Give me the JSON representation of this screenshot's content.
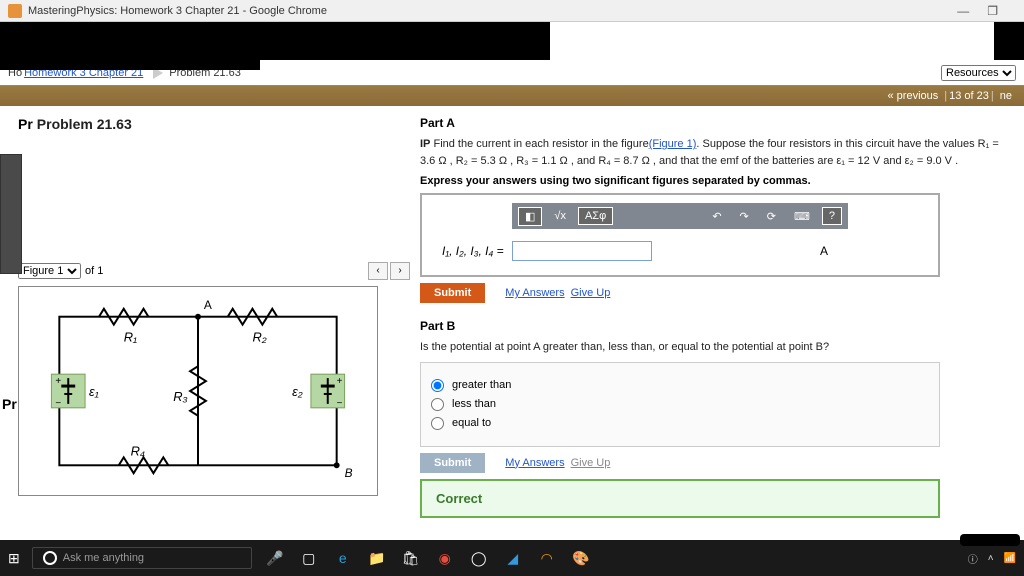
{
  "window": {
    "title": "MasteringPhysics: Homework 3 Chapter 21 - Google Chrome"
  },
  "breadcrumb": {
    "home_prefix": "Ho",
    "link": "Homework 3 Chapter 21",
    "current": "Problem 21.63"
  },
  "resources_label": "Resources",
  "navbar": {
    "prev": "« previous",
    "pos": "13 of 23",
    "next": "ne"
  },
  "problem_title": "Problem 21.63",
  "pr_prefix": "Pr",
  "figure": {
    "select": "Figure 1",
    "of": "of 1"
  },
  "circuit": {
    "R1": "R₁",
    "R2": "R₂",
    "R3": "R₃",
    "R4": "R₄",
    "E1": "ε₁",
    "E2": "ε₂",
    "A": "A",
    "B": "B"
  },
  "partA": {
    "label": "Part A",
    "ip": "IP",
    "prompt1": "Find the current in each resistor in the figure",
    "fig_link": "(Figure 1)",
    "prompt2": ". Suppose the four resistors in this circuit have the values R₁ = 3.6 Ω , R₂ = 5.3 Ω , R₃ = 1.1 Ω , and R₄ = 8.7 Ω , and that the emf of the batteries are ε₁ = 12 V and ε₂ = 9.0 V .",
    "instruct": "Express your answers using two significant figures separated by commas.",
    "toolbar": {
      "t1": "◧",
      "t2": "√x",
      "t3": "ΑΣφ",
      "undo": "↶",
      "redo": "↷",
      "reset": "⟳",
      "kbd": "⌨",
      "help": "?"
    },
    "lhs": "I₁, I₂, I₃, I₄ =",
    "unit": "A",
    "submit": "Submit",
    "myans": "My Answers",
    "giveup": "Give Up"
  },
  "partB": {
    "label": "Part B",
    "prompt": "Is the potential at point A greater than, less than, or equal to the potential at point B?",
    "opt1": "greater than",
    "opt2": "less than",
    "opt3": "equal to",
    "submit": "Submit",
    "myans": "My Answers",
    "giveup": "Give Up",
    "correct": "Correct"
  },
  "taskbar": {
    "cortana": "Ask me anything"
  }
}
